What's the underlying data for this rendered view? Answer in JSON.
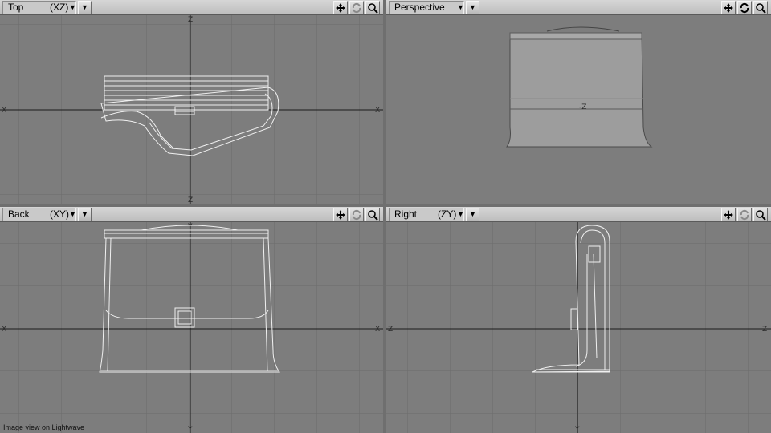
{
  "viewports": {
    "top": {
      "name": "Top",
      "axes": "(XZ)",
      "axis_h": "X",
      "axis_v": "Z"
    },
    "persp": {
      "name": "Perspective",
      "axes": "",
      "axis_center": "-Z"
    },
    "back": {
      "name": "Back",
      "axes": "(XY)",
      "axis_h": "X",
      "axis_v": "Y"
    },
    "right": {
      "name": "Right",
      "axes": "(ZY)",
      "axis_h": "Z",
      "axis_v": "Y"
    }
  },
  "colors": {
    "background": "#7d7d7d",
    "grid": "#6a6a6a",
    "axis": "#1a1a1a",
    "wireframe": "#f2f2f2",
    "shaded": "#9c9c9c"
  },
  "tool_icons": [
    "move-icon",
    "rotate-icon",
    "zoom-icon"
  ],
  "caption": "Image view on Lightwave"
}
